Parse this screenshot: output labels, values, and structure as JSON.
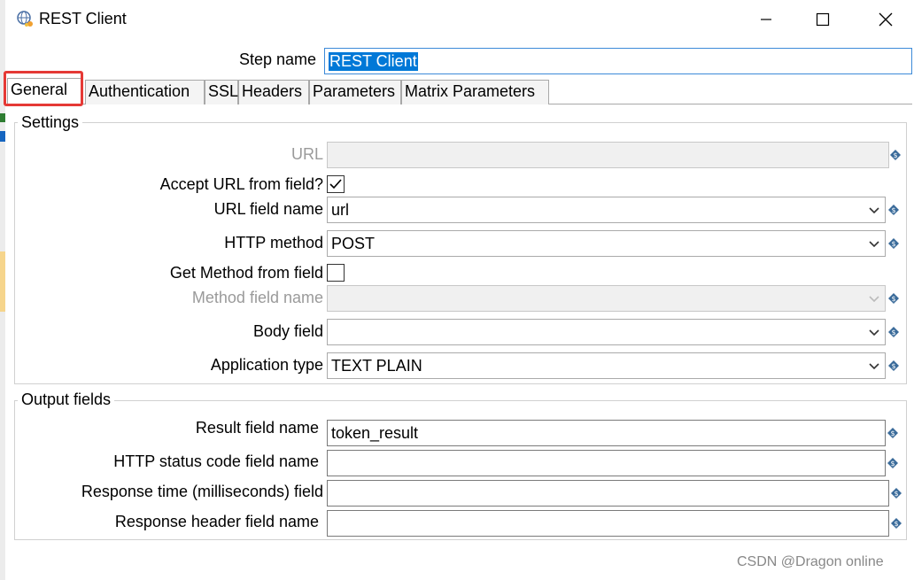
{
  "window": {
    "title": "REST Client"
  },
  "step_name": {
    "label": "Step name",
    "value": "REST Client"
  },
  "tabs": [
    {
      "label": "General"
    },
    {
      "label": "Authentication"
    },
    {
      "label": "SSL"
    },
    {
      "label": "Headers"
    },
    {
      "label": "Parameters"
    },
    {
      "label": "Matrix Parameters"
    }
  ],
  "settings": {
    "title": "Settings",
    "url_label": "URL",
    "url_value": "",
    "accept_url_label": "Accept URL from field?",
    "accept_url_checked": true,
    "url_field_label": "URL field name",
    "url_field_value": "url",
    "http_method_label": "HTTP method",
    "http_method_value": "POST",
    "get_method_label": "Get Method from field",
    "get_method_checked": false,
    "method_field_label": "Method field name",
    "method_field_value": "",
    "body_field_label": "Body field",
    "body_field_value": "",
    "app_type_label": "Application type",
    "app_type_value": "TEXT PLAIN"
  },
  "output": {
    "title": "Output fields",
    "result_label": "Result field name",
    "result_value": "token_result",
    "status_label": "HTTP status code field name",
    "status_value": "",
    "resp_time_label": "Response time (milliseconds) field",
    "resp_time_value": "",
    "resp_header_label": "Response header field name",
    "resp_header_value": ""
  },
  "watermark": "CSDN @Dragon online"
}
